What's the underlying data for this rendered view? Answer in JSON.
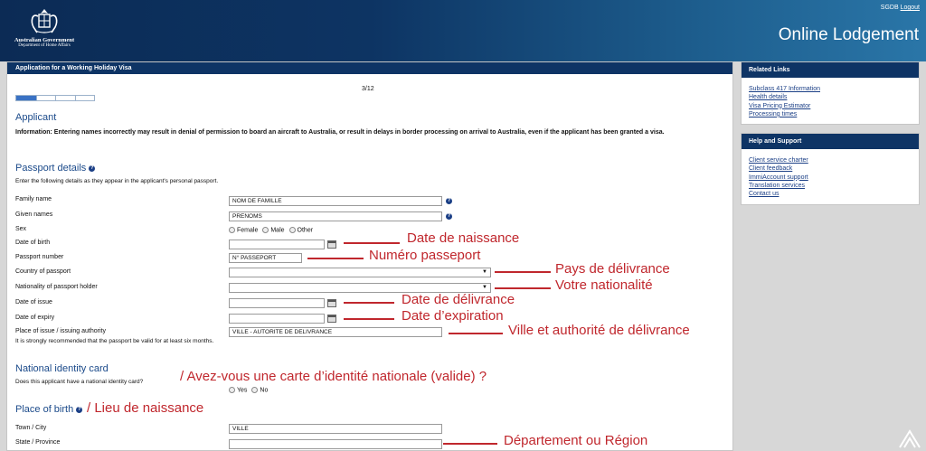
{
  "header": {
    "gov_line1": "Australian Government",
    "gov_line2": "Department of Home Affairs",
    "user": "SGDB",
    "logout": "Logout",
    "title": "Online Lodgement"
  },
  "main": {
    "bar_title": "Application for a Working Holiday Visa",
    "progress": {
      "current": 3,
      "total": 12,
      "fraction": 0.25
    },
    "page_label": "3/12",
    "applicant_title": "Applicant",
    "info_text": "Information: Entering names incorrectly may result in denial of permission to board an aircraft to Australia, or result in delays in border processing on arrival to Australia, even if the applicant has been granted a visa.",
    "passport_title": "Passport details",
    "passport_intro": "Enter the following details as they appear in the applicant's personal passport.",
    "fields": {
      "family_name": {
        "label": "Family name",
        "value": "NOM DE FAMILLE"
      },
      "given_names": {
        "label": "Given names",
        "value": "PRENOMS"
      },
      "sex": {
        "label": "Sex",
        "options": [
          "Female",
          "Male",
          "Other"
        ]
      },
      "dob": {
        "label": "Date of birth",
        "value": ""
      },
      "passport_number": {
        "label": "Passport number",
        "value": "N° PASSEPORT"
      },
      "country": {
        "label": "Country of passport",
        "value": ""
      },
      "nationality": {
        "label": "Nationality of passport holder",
        "value": ""
      },
      "date_issue": {
        "label": "Date of issue",
        "value": ""
      },
      "date_expiry": {
        "label": "Date of expiry",
        "value": ""
      },
      "place_issue": {
        "label": "Place of issue / issuing authority",
        "value": "VILLE - AUTORITE DE DELIVRANCE"
      }
    },
    "validity_note": "It is strongly recommended that the passport be valid for at least six months.",
    "nid_title": "National identity card",
    "nid_question": "Does this applicant have a national identity card?",
    "nid_options": [
      "Yes",
      "No"
    ],
    "pob_title": "Place of birth",
    "town_label": "Town / City",
    "town_value": "VILLE",
    "state_label": "State / Province",
    "state_value": ""
  },
  "sidebar": {
    "related_title": "Related Links",
    "related_links": [
      "Subclass 417 Information",
      "Health details",
      "Visa Pricing Estimator",
      "Processing times"
    ],
    "help_title": "Help and Support",
    "help_links": [
      "Client service charter",
      "Client feedback",
      "ImmiAccount support",
      "Translation services",
      "Contact us"
    ]
  },
  "annotations": {
    "dob": "Date de naissance",
    "passport": "Numéro passeport",
    "country": "Pays de délivrance",
    "nationality": "Votre nationalité",
    "issue": "Date de délivrance",
    "expiry": "Date d’expiration",
    "place": "Ville et authorité de délivrance",
    "nid": "/  Avez-vous une carte d’identité nationale (valide) ?",
    "pob": "/  Lieu de naissance",
    "state": "Département ou Région"
  },
  "colors": {
    "header": "#0c2b55",
    "bar": "#0e3465",
    "link": "#1b3f86",
    "annotation": "#c0272d",
    "title": "#1b4a8a"
  }
}
